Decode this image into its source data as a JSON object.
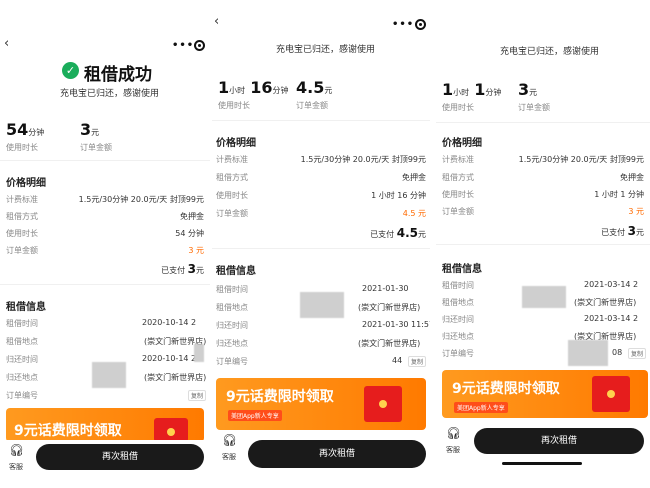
{
  "screens": [
    {
      "back": "‹",
      "capsule": "•••",
      "success_title": "租借成功",
      "subtitle": "充电宝已归还，感谢使用",
      "stats": [
        {
          "value": "54",
          "unit": "分钟",
          "label": "使用时长"
        },
        {
          "value": "3",
          "unit": "元",
          "label": "订单金额"
        }
      ],
      "price_section_title": "价格明细",
      "price_rows": [
        {
          "label": "计费标准",
          "value": "1.5元/30分钟 20.0元/天 封顶99元"
        },
        {
          "label": "租借方式",
          "value": "免押金"
        },
        {
          "label": "使用时长",
          "value": "54 分钟"
        },
        {
          "label": "订单金额",
          "value": "3 元"
        }
      ],
      "paid_prefix": "已支付",
      "paid_amount": "3",
      "paid_unit": "元",
      "rental_section_title": "租借信息",
      "rental_rows": [
        {
          "label": "租借时间",
          "value": "2020-10-14 2"
        },
        {
          "label": "租借地点",
          "value": "(崇文门新世界店)"
        },
        {
          "label": "归还时间",
          "value": "2020-10-14 2"
        },
        {
          "label": "归还地点",
          "value": "(崇文门新世界店)"
        },
        {
          "label": "订单编号",
          "value": ""
        }
      ],
      "copy_label": "复制",
      "banner_title": "9元话费限时领取",
      "service_label": "客服",
      "button_label": "再次租借"
    },
    {
      "back": "‹",
      "capsule": "•••",
      "subtitle": "充电宝已归还，感谢使用",
      "stats": [
        {
          "value1": "1",
          "unit1": "小时",
          "value2": "16",
          "unit2": "分钟",
          "label": "使用时长"
        },
        {
          "value": "4.5",
          "unit": "元",
          "label": "订单金额"
        }
      ],
      "price_section_title": "价格明细",
      "price_rows": [
        {
          "label": "计费标准",
          "value": "1.5元/30分钟 20.0元/天 封顶99元"
        },
        {
          "label": "租借方式",
          "value": "免押金"
        },
        {
          "label": "使用时长",
          "value": "1 小时 16 分钟"
        },
        {
          "label": "订单金额",
          "value": "4.5 元"
        }
      ],
      "paid_prefix": "已支付",
      "paid_amount": "4.5",
      "paid_unit": "元",
      "rental_section_title": "租借信息",
      "rental_rows": [
        {
          "label": "租借时间",
          "value": "2021-01-30"
        },
        {
          "label": "租借地点",
          "value": "(崇文门新世界店)"
        },
        {
          "label": "归还时间",
          "value": "2021-01-30 11:57"
        },
        {
          "label": "归还地点",
          "value": "(崇文门新世界店)"
        },
        {
          "label": "订单编号",
          "value": "44"
        }
      ],
      "copy_label": "复制",
      "banner_title": "9元话费限时领取",
      "banner_tag": "美团App新人专享",
      "service_label": "客服",
      "button_label": "再次租借"
    },
    {
      "subtitle": "充电宝已归还，感谢使用",
      "stats": [
        {
          "value1": "1",
          "unit1": "小时",
          "value2": "1",
          "unit2": "分钟",
          "label": "使用时长"
        },
        {
          "value": "3",
          "unit": "元",
          "label": "订单金额"
        }
      ],
      "price_section_title": "价格明细",
      "price_rows": [
        {
          "label": "计费标准",
          "value": "1.5元/30分钟 20.0元/天 封顶99元"
        },
        {
          "label": "租借方式",
          "value": "免押金"
        },
        {
          "label": "使用时长",
          "value": "1 小时 1 分钟"
        },
        {
          "label": "订单金额",
          "value": "3 元"
        }
      ],
      "paid_prefix": "已支付",
      "paid_amount": "3",
      "paid_unit": "元",
      "rental_section_title": "租借信息",
      "rental_rows": [
        {
          "label": "租借时间",
          "value": "2021-03-14 2"
        },
        {
          "label": "租借地点",
          "value": "(崇文门新世界店)"
        },
        {
          "label": "归还时间",
          "value": "2021-03-14 2"
        },
        {
          "label": "归还地点",
          "value": "(崇文门新世界店)"
        },
        {
          "label": "订单编号",
          "value": "08"
        }
      ],
      "copy_label": "复制",
      "banner_title": "9元话费限时领取",
      "banner_tag": "美团App新人专享",
      "service_label": "客服",
      "button_label": "再次租借"
    }
  ],
  "colors": {
    "success_green": "#1aad5b",
    "accent_orange": "#ff6a00",
    "button_dark": "#1a1a1a",
    "banner_orange": "#ff8c00"
  },
  "icons": {
    "success": "check-circle-icon",
    "service": "headset-icon",
    "more": "more-dots-icon",
    "target": "target-icon",
    "back": "back-chevron-icon"
  }
}
